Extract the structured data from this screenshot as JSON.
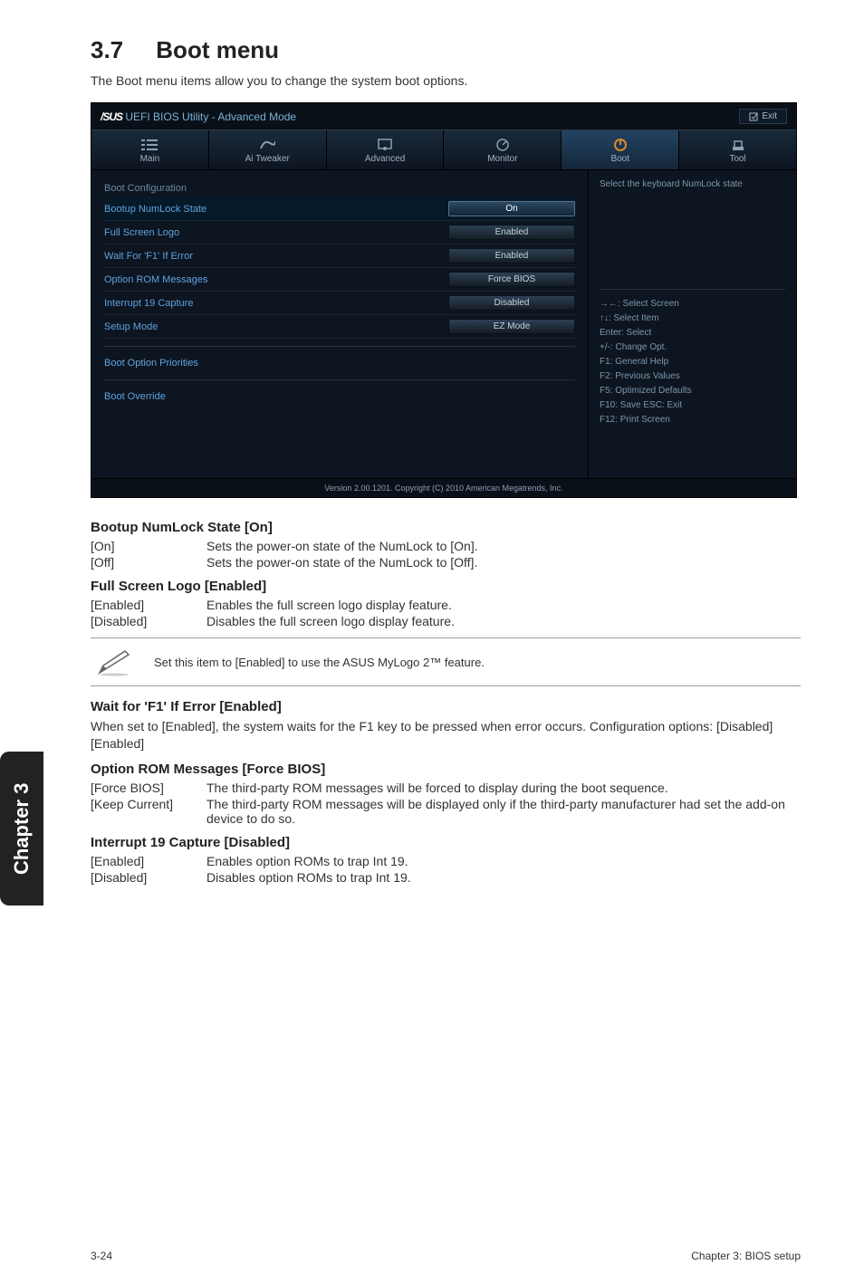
{
  "section": {
    "number": "3.7",
    "title": "Boot menu"
  },
  "intro": "The Boot menu items allow you to change the system boot options.",
  "bios": {
    "brand": "/SUS",
    "util_title": "UEFI BIOS Utility - Advanced Mode",
    "exit_label": "Exit",
    "tabs": {
      "main": "Main",
      "tweaker": "Ai Tweaker",
      "advanced": "Advanced",
      "monitor": "Monitor",
      "boot": "Boot",
      "tool": "Tool"
    },
    "left": {
      "boot_config_head": "Boot Configuration",
      "rows": [
        {
          "label": "Bootup NumLock State",
          "value": "On",
          "highlight": true
        },
        {
          "label": "Full Screen Logo",
          "value": "Enabled"
        },
        {
          "label": "Wait For 'F1' If Error",
          "value": "Enabled"
        },
        {
          "label": "Option ROM Messages",
          "value": "Force BIOS"
        },
        {
          "label": "Interrupt 19 Capture",
          "value": "Disabled"
        },
        {
          "label": "Setup Mode",
          "value": "EZ Mode"
        }
      ],
      "priorities_head": "Boot Option Priorities",
      "override_head": "Boot Override"
    },
    "right": {
      "help_line": "Select the keyboard NumLock state",
      "nav": [
        "→←: Select Screen",
        "↑↓: Select Item",
        "Enter: Select",
        "+/-: Change Opt.",
        "F1: General Help",
        "F2: Previous Values",
        "F5: Optimized Defaults",
        "F10: Save   ESC: Exit",
        "F12: Print Screen"
      ]
    },
    "footer": "Version 2.00.1201. Copyright (C) 2010 American Megatrends, Inc."
  },
  "doc": {
    "numlock": {
      "head": "Bootup NumLock State [On]",
      "on_k": "[On]",
      "on_v": "Sets the power-on state of the NumLock to [On].",
      "off_k": "[Off]",
      "off_v": "Sets the power-on state of the NumLock to [Off]."
    },
    "logo": {
      "head": "Full Screen Logo [Enabled]",
      "en_k": "[Enabled]",
      "en_v": "Enables the full screen logo display feature.",
      "dis_k": "[Disabled]",
      "dis_v": "Disables the full screen logo display feature."
    },
    "note": "Set this item to [Enabled] to use the ASUS MyLogo 2™ feature.",
    "waitf1": {
      "head": "Wait for 'F1' If Error [Enabled]",
      "body": "When set to [Enabled], the system waits for the F1 key to be pressed when error occurs. Configuration options: [Disabled] [Enabled]"
    },
    "optrom": {
      "head": "Option ROM Messages [Force BIOS]",
      "fb_k": "[Force BIOS]",
      "fb_v": "The third-party ROM messages will be forced to display during the boot sequence.",
      "kc_k": "[Keep Current]",
      "kc_v": "The third-party ROM messages will be displayed only if the third-party manufacturer had set the add-on device to do so."
    },
    "int19": {
      "head": "Interrupt 19 Capture [Disabled]",
      "en_k": "[Enabled]",
      "en_v": "Enables option ROMs to trap Int 19.",
      "dis_k": "[Disabled]",
      "dis_v": "Disables option ROMs to trap Int 19."
    }
  },
  "chapter_tab": "Chapter 3",
  "footer": {
    "left": "3-24",
    "right": "Chapter 3: BIOS setup"
  }
}
